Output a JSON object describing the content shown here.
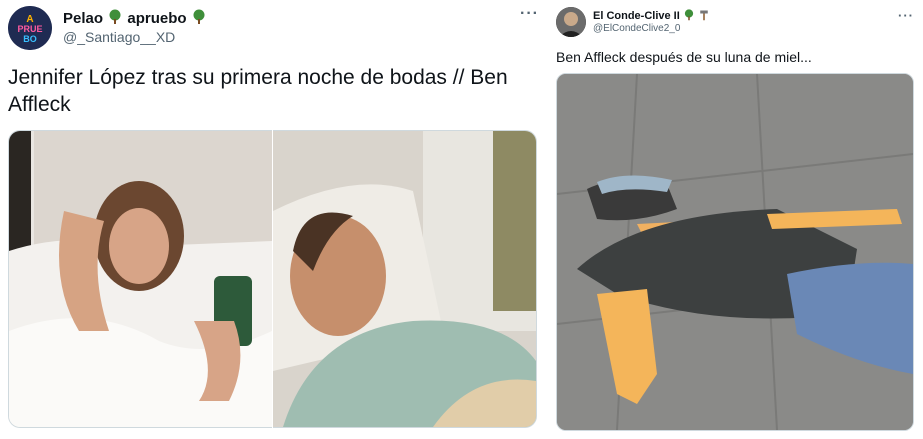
{
  "tweet_left": {
    "author_name": "Pelao",
    "author_word2": "apruebo",
    "handle": "@_Santiago__XD",
    "text": "Jennifer López tras su primera noche de bodas // Ben Affleck",
    "avatar_text": "A PRUE BO",
    "more_icon": "more-horizontal-icon",
    "images": [
      "woman-in-bed-photo",
      "man-sleeping-photo"
    ]
  },
  "tweet_right": {
    "author_name": "El Conde-Clive II",
    "handle": "@ElCondeClive2_0",
    "text": "Ben Affleck después de su luna de miel...",
    "more_icon": "more-horizontal-icon",
    "images": [
      "flat-man-on-floor-photo"
    ]
  },
  "colors": {
    "avatar_bg": "#1f2b52",
    "tree_green": "#3f8f3a",
    "muted": "#536471"
  }
}
